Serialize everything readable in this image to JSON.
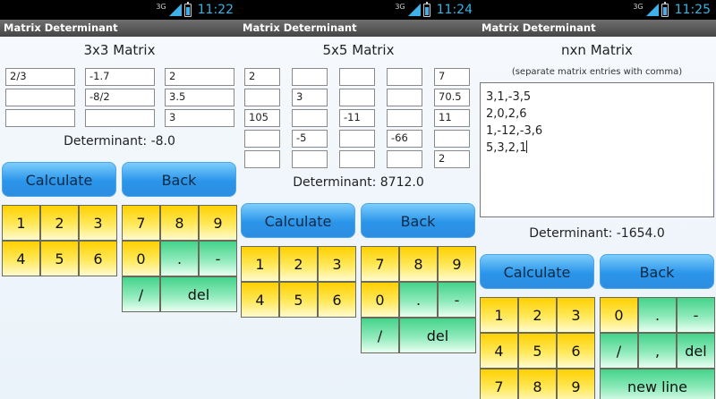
{
  "app_title": "Matrix Determinant",
  "calculate_label": "Calculate",
  "back_label": "Back",
  "del_label": "del",
  "net_label": "3G",
  "screens": [
    {
      "time": "11:22",
      "matrix_title": "3x3 Matrix",
      "rows": [
        [
          "2/3",
          "-1.7",
          "2"
        ],
        [
          "",
          "-8/2",
          "3.5"
        ],
        [
          "",
          "",
          "3"
        ]
      ],
      "determinant": "Determinant: -8.0"
    },
    {
      "time": "11:24",
      "matrix_title": "5x5 Matrix",
      "rows": [
        [
          "2",
          "",
          "",
          "",
          "7"
        ],
        [
          "",
          "3",
          "",
          "",
          "70.5"
        ],
        [
          "105",
          "",
          "-11",
          "",
          "11"
        ],
        [
          "",
          "-5",
          "",
          "-66",
          ""
        ],
        [
          "",
          "",
          "",
          "",
          "2"
        ]
      ],
      "determinant": "Determinant: 8712.0"
    },
    {
      "time": "11:25",
      "matrix_title": "nxn Matrix",
      "hint": "(separate matrix entries with comma)",
      "text_lines": [
        "3,1,-3,5",
        "2,0,2,6",
        "1,-12,-3,6",
        "5,3,2,1"
      ],
      "determinant": "Determinant: -1654.0",
      "new_line_label": "new line"
    }
  ],
  "keys": {
    "digits_a": [
      "1",
      "2",
      "3",
      "4",
      "5",
      "6"
    ],
    "digits_b": [
      "7",
      "8",
      "9"
    ],
    "zero": "0",
    "dot": ".",
    "minus": "-",
    "slash": "/",
    "comma": ","
  }
}
